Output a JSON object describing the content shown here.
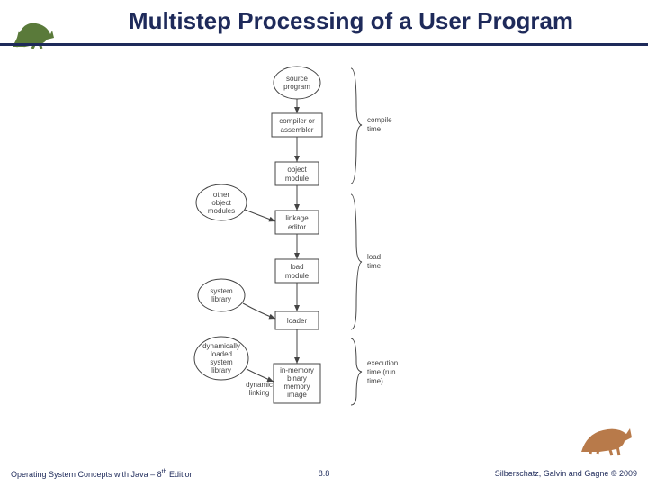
{
  "slide": {
    "title": "Multistep Processing of a User Program",
    "footer_left_prefix": "Operating System Concepts with Java – 8",
    "footer_left_sup": "th",
    "footer_left_suffix": " Edition",
    "footer_center": "8.8",
    "footer_right": "Silberschatz, Galvin and Gagne © 2009"
  },
  "diagram": {
    "ovals": {
      "source": [
        "source",
        "program"
      ],
      "other_obj": [
        "other",
        "object",
        "modules"
      ],
      "system_lib": [
        "system",
        "library"
      ],
      "dyn_lib": [
        "dynamically",
        "loaded",
        "system",
        "library"
      ]
    },
    "rects": {
      "compiler": [
        "compiler or",
        "assembler"
      ],
      "object_mod": [
        "object",
        "module"
      ],
      "linkage": [
        "linkage",
        "editor"
      ],
      "load_mod": [
        "load",
        "module"
      ],
      "loader": [
        "loader"
      ],
      "memimg": [
        "in-memory",
        "binary",
        "memory",
        "image"
      ]
    },
    "labels": {
      "dyn_link": [
        "dynamic",
        "linking"
      ]
    },
    "braces": {
      "compile": [
        "compile",
        "time"
      ],
      "load": [
        "load",
        "time"
      ],
      "exec": [
        "execution",
        "time (run",
        "time)"
      ]
    }
  }
}
